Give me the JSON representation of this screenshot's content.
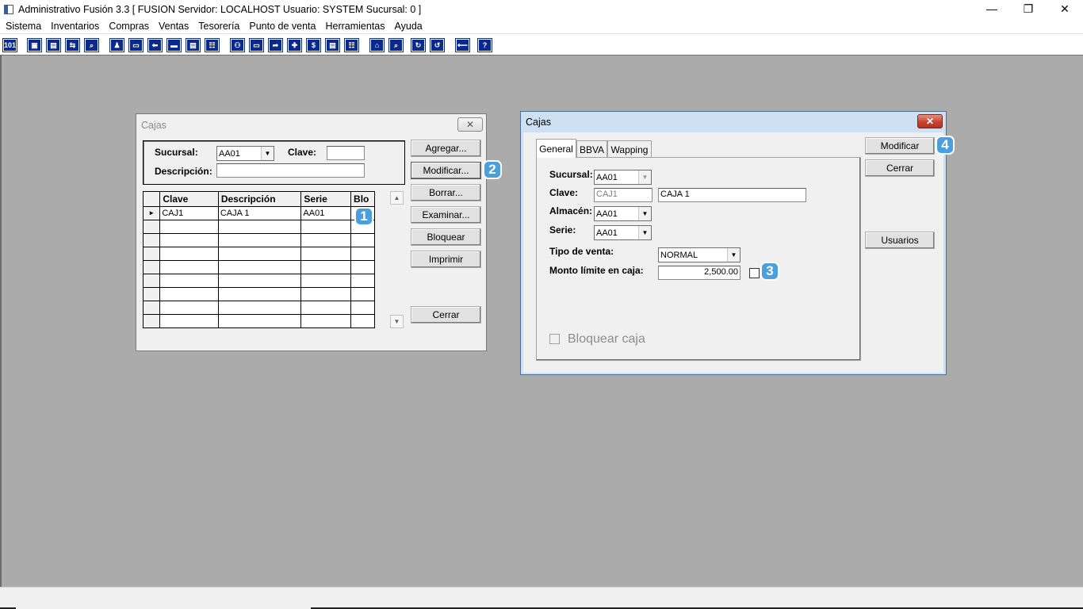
{
  "app": {
    "title": "Administrativo Fusión 3.3 [ FUSION   Servidor: LOCALHOST   Usuario: SYSTEM    Sucursal: 0 ]",
    "minimize": "—",
    "restore": "❐",
    "close": "✕"
  },
  "menu": [
    "Sistema",
    "Inventarios",
    "Compras",
    "Ventas",
    "Tesorería",
    "Punto de venta",
    "Herramientas",
    "Ayuda"
  ],
  "toolbar_glyphs": [
    "101",
    "▣",
    "▤",
    "⇆",
    "⌕",
    "♟",
    "▭",
    "⬅",
    "▬",
    "▤",
    "☷",
    "⚇",
    "▭",
    "➦",
    "✚",
    "$",
    "▤",
    "☷",
    "⌂",
    "⌕",
    "↻",
    "↺",
    "⟵",
    "?"
  ],
  "cajas_list": {
    "title": "Cajas",
    "close_glyph": "✕",
    "sucursal_label": "Sucursal:",
    "sucursal_value": "AA01",
    "clave_label": "Clave:",
    "clave_value": "",
    "descripcion_label": "Descripción:",
    "descripcion_value": "",
    "columns": [
      "Clave",
      "Descripción",
      "Serie",
      "Blo"
    ],
    "rows": [
      {
        "indicator": "►",
        "clave": "CAJ1",
        "descripcion": "CAJA 1",
        "serie": "AA01",
        "blo": ""
      }
    ],
    "buttons": {
      "agregar": "Agregar...",
      "modificar": "Modificar...",
      "borrar": "Borrar...",
      "examinar": "Examinar...",
      "bloquear": "Bloquear",
      "imprimir": "Imprimir",
      "cerrar": "Cerrar"
    }
  },
  "cajas_detail": {
    "title": "Cajas",
    "close_glyph": "✕",
    "tabs": [
      "General",
      "BBVA",
      "Wapping"
    ],
    "sucursal_label": "Sucursal:",
    "sucursal_value": "AA01",
    "clave_label": "Clave:",
    "clave_value": "CAJ1",
    "clave_desc_value": "CAJA 1",
    "almacen_label": "Almacén:",
    "almacen_value": "AA01",
    "serie_label": "Serie:",
    "serie_value": "AA01",
    "tipo_venta_label": "Tipo de venta:",
    "tipo_venta_value": "NORMAL",
    "monto_label": "Monto límite en caja:",
    "monto_value": "2,500.00",
    "bloquear_caja_label": "Bloquear caja",
    "buttons": {
      "modificar": "Modificar",
      "cerrar": "Cerrar",
      "usuarios": "Usuarios"
    }
  },
  "badges": [
    "1",
    "2",
    "3",
    "4"
  ]
}
